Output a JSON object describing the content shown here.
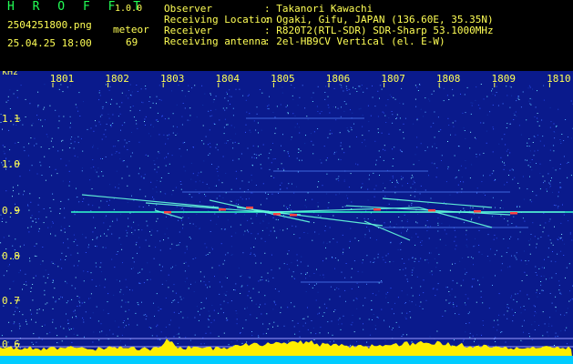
{
  "header": {
    "app_name": "H R O F F T",
    "app_version": "1.0.0",
    "file_name": "2504251800.png",
    "timestamp": "25.04.25 18:00",
    "meteor_label": "meteor",
    "meteor_count": "69",
    "info": [
      {
        "key": "Observer",
        "value": ": Takanori Kawachi"
      },
      {
        "key": "Receiving Location",
        "value": ": Ogaki, Gifu, JAPAN (136.60E, 35.35N)"
      },
      {
        "key": "Receiver",
        "value": ": R820T2(RTL-SDR) SDR-Sharp 53.1000MHz"
      },
      {
        "key": "Receiving antenna",
        "value": ": 2el-HB9CV Vertical (el. E-W)"
      }
    ]
  },
  "spectrogram": {
    "unit_label": "kHz",
    "minute_labels": [
      "1801",
      "1802",
      "1803",
      "1804",
      "1805",
      "1806",
      "1807",
      "1808",
      "1809",
      "1810"
    ],
    "freq_labels": [
      "1.1",
      "1.0",
      "0.9",
      "0.8",
      "0.7",
      "0.6"
    ],
    "colors": {
      "background": "#0a1a8c",
      "carrier": "#33ffcc",
      "echo_hot": "#ff4444",
      "spectrum": "#ffee00",
      "floor": "#00ccff"
    }
  }
}
